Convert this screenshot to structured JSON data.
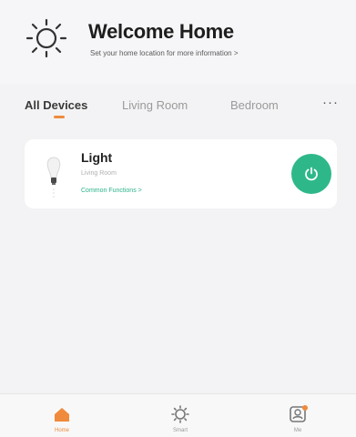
{
  "header": {
    "icon": "sun-icon",
    "title": "Welcome Home",
    "subtitle": "Set your home location for more information >"
  },
  "tabs": {
    "items": [
      {
        "label": "All Devices"
      },
      {
        "label": "Living Room"
      },
      {
        "label": "Bedroom"
      }
    ],
    "more_label": "···",
    "active_index": 0
  },
  "device": {
    "icon": "light-bulb-icon",
    "name": "Light",
    "room": "Living Room",
    "functions_link": "Common Functions >",
    "power_icon": "power-icon",
    "state_color": "#2eb88a"
  },
  "bottom_nav": {
    "items": [
      {
        "icon": "home-icon",
        "label": "Home"
      },
      {
        "icon": "smart-icon",
        "label": "Smart"
      },
      {
        "icon": "profile-icon",
        "label": "Me"
      }
    ],
    "active_index": 0,
    "accent_color": "#f08a3c"
  }
}
